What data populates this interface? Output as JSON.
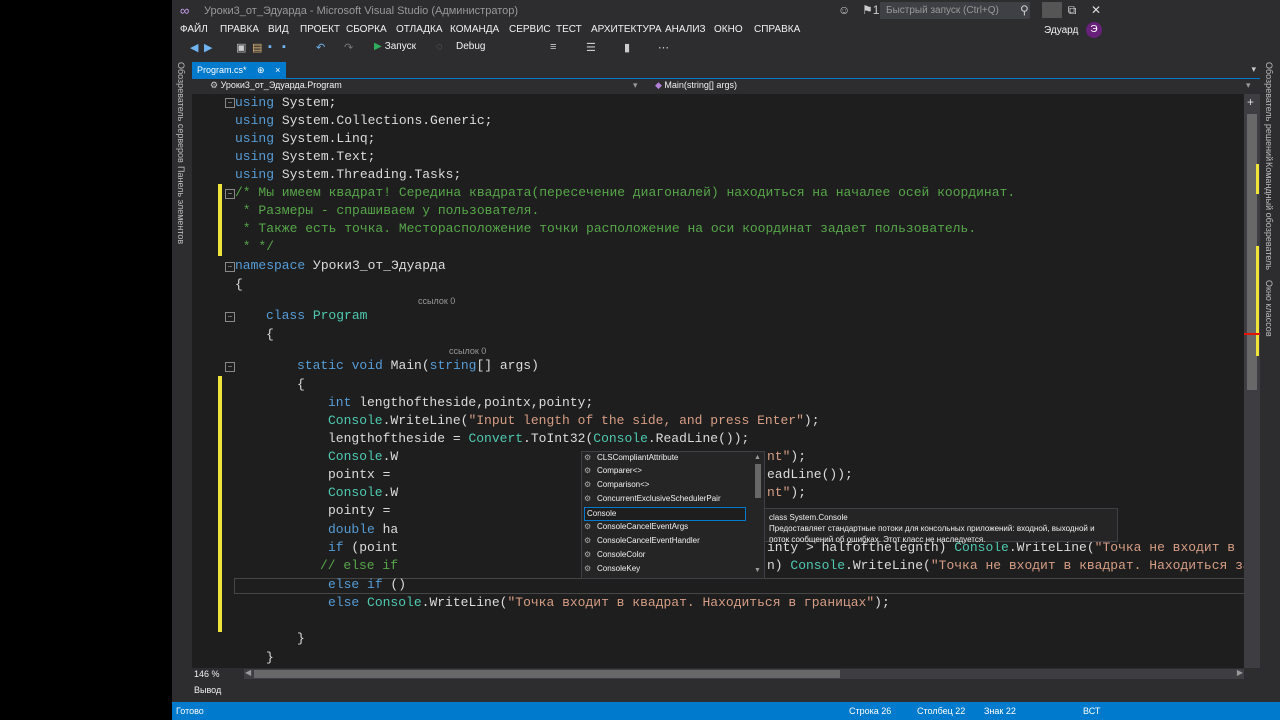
{
  "window": {
    "title": "Уроки3_от_Эдуарда - Microsoft Visual Studio (Администратор)",
    "quick_launch_placeholder": "Быстрый запуск (Ctrl+Q)",
    "notifications_count": "1",
    "user": "Эдуард",
    "user_badge": "Э"
  },
  "menu": [
    "ФАЙЛ",
    "ПРАВКА",
    "ВИД",
    "ПРОЕКТ",
    "СБОРКА",
    "ОТЛАДКА",
    "КОМАНДА",
    "СЕРВИС",
    "ТЕСТ",
    "АРХИТЕКТУРА",
    "АНАЛИЗ",
    "ОКНО",
    "СПРАВКА"
  ],
  "toolbar": {
    "run_label": "Запуск",
    "config": "Debug"
  },
  "left_panels": [
    "Обозреватель серверов",
    "Панель элементов"
  ],
  "right_panels": [
    "Обозреватель решений",
    "Командный обозреватель",
    "Окно классов"
  ],
  "tab": {
    "name": "Program.cs*",
    "close": "×",
    "pin": "⊕"
  },
  "nav": {
    "class": "Уроки3_от_Эдуарда.Program",
    "member": "Main(string[] args)"
  },
  "code": {
    "u1_kw": "using",
    "u1": " System;",
    "u2_kw": "using",
    "u2": " System.Collections.Generic;",
    "u3_kw": "using",
    "u3": " System.Linq;",
    "u4_kw": "using",
    "u4": " System.Text;",
    "u5_kw": "using",
    "u5": " System.Threading.Tasks;",
    "c1": "/* Мы имеем квадрат! Середина квадрата(пересечение диагоналей) находиться на началее осей координат.",
    "c2": " * Размеры - спрашиваем у пользователя.",
    "c3": " * Также есть точка. Месторасположение точки расположение на оси координат задает пользователь.",
    "c4": " * */",
    "ns_kw": "namespace",
    "ns": " Уроки3_от_Эдуарда",
    "brace_open": "{",
    "lens1": "ссылок 0",
    "class_kw": "class",
    "class_name": "Program",
    "brace2": "{",
    "lens2": "ссылок 0",
    "main_kw1": "static",
    "main_kw2": "void",
    "main_name": " Main(",
    "main_kw3": "string",
    "main_rest": "[] args)",
    "brace3": "{",
    "l1_kw": "int",
    "l1": " lengthoftheside,pointx,pointy;",
    "l2_cls": "Console",
    "l2_a": ".WriteLine(",
    "l2_str": "\"Input length of the side, and press Enter\"",
    "l2_b": ");",
    "l3_a": "lengthoftheside = ",
    "l3_cls1": "Convert",
    "l3_b": ".ToInt32(",
    "l3_cls2": "Console",
    "l3_c": ".ReadLine());",
    "l4_cls": "Console",
    "l4_a": ".W",
    "l4_tail_str": "nt\"",
    "l4_tail": ");",
    "l5_a": "pointx = ",
    "l5_tail": "eadLine());",
    "l6_cls": "Console",
    "l6_a": ".W",
    "l6_tail_str": "nt\"",
    "l6_tail": ");",
    "l7_a": "pointy = ",
    "l8_kw": "double",
    "l8_a": " ha",
    "l9_kw": "if",
    "l9_a": " (point",
    "l9_tail_a": "inty > halfofthelegnth) ",
    "l9_tail_cls": "Console",
    "l9_tail_b": ".WriteLine(",
    "l9_tail_str": "\"Точка не входит в ква",
    "l10_cm": "// else if",
    "l10_tail_a": "n) ",
    "l10_tail_cls": "Console",
    "l10_tail_b": ".WriteLine(",
    "l10_tail_str": "\"Точка не входит в квадрат. Находиться за г",
    "l11_kw1": "else",
    "l11_kw2": " if",
    "l11_a": " ()",
    "l12_kw": "else",
    "l12_cls": " Console",
    "l12_a": ".WriteLine(",
    "l12_str": "\"Точка входит в квадрат. Находиться в границах\"",
    "l12_b": ");",
    "brace_close_method": "}",
    "brace_close_class": "}"
  },
  "intellisense": {
    "items": [
      "CLSCompliantAttribute",
      "Comparer<>",
      "Comparison<>",
      "ConcurrentExclusiveSchedulerPair",
      "Console",
      "ConsoleCancelEventArgs",
      "ConsoleCancelEventHandler",
      "ConsoleColor",
      "ConsoleKey"
    ],
    "selected_index": 4,
    "tooltip_title": "class System.Console",
    "tooltip_line1": "Предоставляет стандартные потоки для консольных приложений: входной, выходной и",
    "tooltip_line2": "поток сообщений об ошибках. Этот класс не наследуется."
  },
  "editor": {
    "zoom": "146 %"
  },
  "output_tab": "Вывод",
  "status": {
    "ready": "Готово",
    "line": "Строка 26",
    "col": "Столбец 22",
    "char": "Знак 22",
    "mode": "ВСТ"
  },
  "colors": {
    "accent": "#007acc",
    "keyword": "#569cd6",
    "type": "#4ec9b0",
    "string": "#d69d85",
    "comment": "#57a64a",
    "changed": "#efe43a"
  }
}
